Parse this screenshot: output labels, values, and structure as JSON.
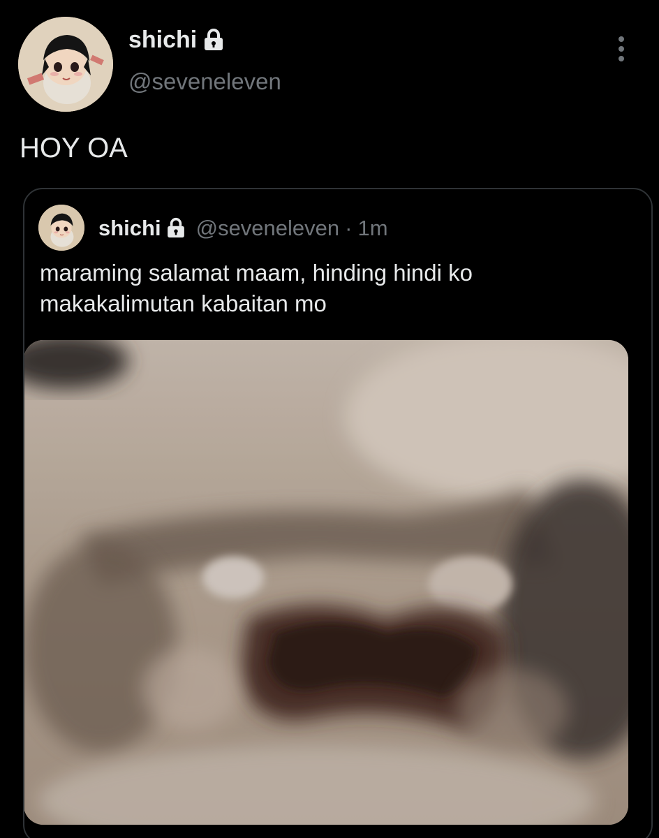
{
  "tweet": {
    "author": {
      "display_name": "shichi",
      "handle": "@seveneleven",
      "protected_icon": "lock-icon",
      "avatar_icon": "avatar-doll-image"
    },
    "text": "HOY OA",
    "menu_icon": "more-vertical-icon"
  },
  "quoted_tweet": {
    "author": {
      "display_name": "shichi",
      "handle": "@seveneleven",
      "protected_icon": "lock-icon"
    },
    "separator": "·",
    "time": "1m",
    "text": "maraming salamat maam, hinding hindi ko makakalimutan kabaitan mo",
    "media_icon": "crying-face-image"
  },
  "colors": {
    "background": "#000000",
    "primary_text": "#e7e9ea",
    "secondary_text": "#71767b",
    "border": "#2f3336"
  }
}
